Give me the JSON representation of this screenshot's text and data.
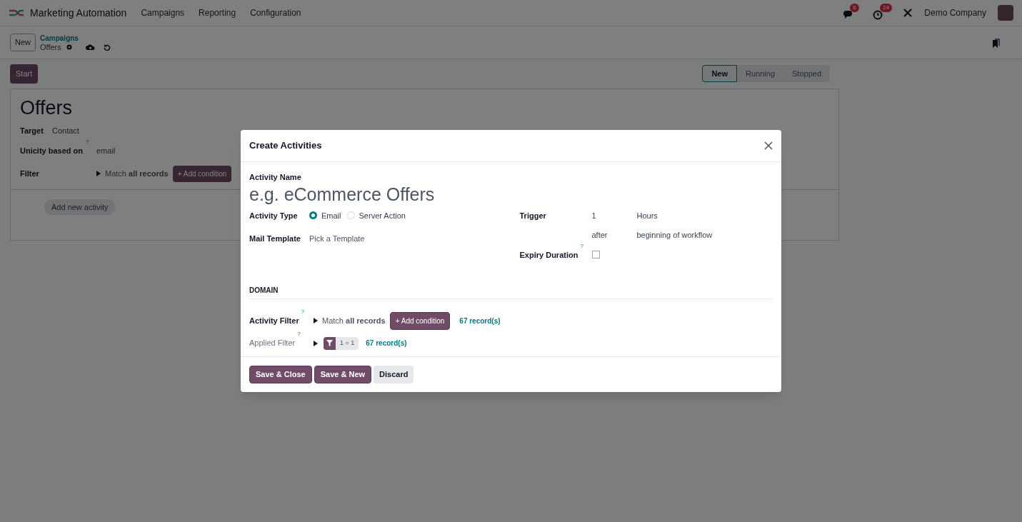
{
  "navbar": {
    "app_name": "Marketing Automation",
    "menu": [
      "Campaigns",
      "Reporting",
      "Configuration"
    ],
    "messages_badge": "6",
    "activities_badge": "24",
    "company": "Demo Company"
  },
  "control_panel": {
    "new_button": "New",
    "breadcrumb": "Campaigns",
    "record": "Offers"
  },
  "start_button": "Start",
  "stages": [
    {
      "label": "New",
      "selected": true
    },
    {
      "label": "Running",
      "selected": false
    },
    {
      "label": "Stopped",
      "selected": false
    }
  ],
  "form": {
    "title": "Offers",
    "fields": [
      {
        "label": "Target",
        "value": "Contact"
      },
      {
        "label": "Unicity based on",
        "help": "?",
        "value": "email"
      }
    ],
    "filter": {
      "label": "Filter",
      "match": "Match **all records**",
      "add_condition": "+ Add condition"
    },
    "add_activity": "Add new activity"
  },
  "dialog": {
    "title": "Create Activities",
    "activity_name": {
      "label": "Activity Name",
      "placeholder": "e.g. eCommerce Offers"
    },
    "activity_type": {
      "label": "Activity Type",
      "options": [
        {
          "label": "Email",
          "selected": true
        },
        {
          "label": "Server Action",
          "selected": false
        }
      ]
    },
    "mail_template": {
      "label": "Mail Template",
      "placeholder": "Pick a Template"
    },
    "trigger": {
      "label": "Trigger",
      "amount": "1",
      "unit": "Hours",
      "relation": "after",
      "event": "beginning of workflow"
    },
    "expiry": {
      "label": "Expiry Duration",
      "help": "?",
      "checked": false
    },
    "domain_header": "DOMAIN",
    "activity_filter": {
      "label": "Activity Filter",
      "help": "?",
      "match": "Match **all records**",
      "add_condition": "+ Add condition",
      "records": "67 record(s)"
    },
    "applied_filter": {
      "label": "Applied Filter",
      "help": "?",
      "domain": "1 = 1",
      "records": "67 record(s)"
    },
    "buttons": [
      {
        "label": "Save & Close",
        "kind": "primary"
      },
      {
        "label": "Save & New",
        "kind": "primary"
      },
      {
        "label": "Discard",
        "kind": "secondary"
      }
    ]
  }
}
